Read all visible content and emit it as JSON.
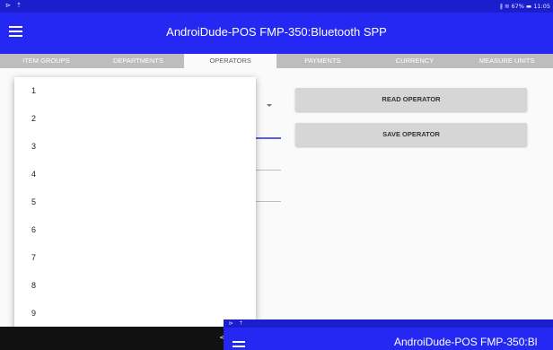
{
  "status_bar": {
    "left_icons": "⊳ ⇡",
    "right_text": "∦ ≋ 67% ▬ 11:05"
  },
  "app_bar": {
    "menu_icon": "hamburger-menu-icon",
    "title": "AndroiDude-POS   FMP-350:Bluetooth SPP"
  },
  "tabs": [
    {
      "label": "ITEM GROUPS",
      "active": false
    },
    {
      "label": "DEPARTMENTS",
      "active": false
    },
    {
      "label": "OPERATORS",
      "active": true
    },
    {
      "label": "PAYMENTS",
      "active": false
    },
    {
      "label": "CURRENCY",
      "active": false
    },
    {
      "label": "MEASURE UNITS",
      "active": false
    }
  ],
  "buttons": {
    "read_operator": "READ OPERATOR",
    "save_operator": "SAVE OPERATOR"
  },
  "dropdown": {
    "items": [
      "1",
      "2",
      "3",
      "4",
      "5",
      "6",
      "7",
      "8",
      "9"
    ]
  },
  "nav_bar": {
    "back_icon": "back-icon",
    "back_glyph": "<"
  },
  "overlay": {
    "status_icons": "⊳ ⇡",
    "title": "AndroiDude-POS   FMP-350:Bl"
  },
  "colors": {
    "app_bar": "#2528f2",
    "status_bar": "#1a1ecc",
    "tab_bar": "#bdbdbd",
    "button": "#d6d6d6",
    "focus_underline": "#5a5ee6"
  }
}
